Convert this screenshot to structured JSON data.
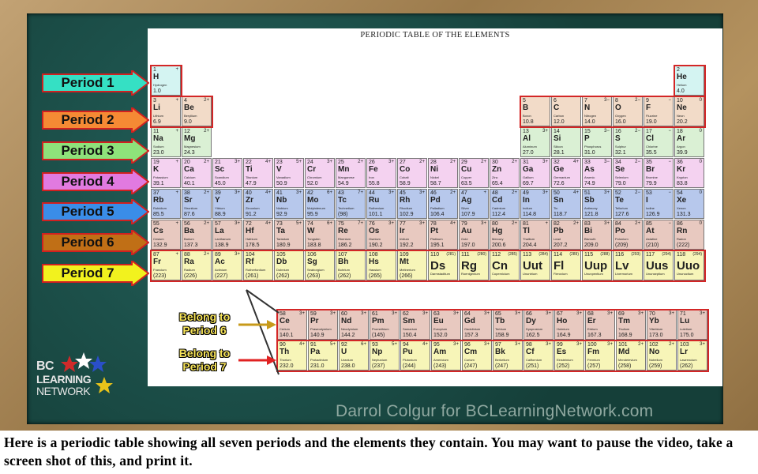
{
  "table_title": "PERIODIC TABLE OF THE ELEMENTS",
  "period_labels": [
    "Period 1",
    "Period 2",
    "Period 3",
    "Period 4",
    "Period 5",
    "Period 6",
    "Period 7"
  ],
  "belong_labels": [
    "Belong to Period 6",
    "Belong to Period 7"
  ],
  "logo": {
    "line1": "BC",
    "line2": "LEARNING",
    "line3": "NETWORK"
  },
  "credit": "Darrol Colgur for BCLearningNetwork.com",
  "caption": "Here is a periodic table showing all seven periods and the elements they contain. You may want to pause the video, take a screen shot of this, and print it.",
  "colors": {
    "period1": "#d4f4f2",
    "period2": "#f2dbc8",
    "period3": "#daf0d4",
    "period4": "#f4d2f0",
    "period5": "#b7c8ec",
    "period6": "#e8c9c0",
    "period7": "#f7f5b8",
    "outline": "#d32626",
    "arrow1": "#35e0c4",
    "arrow2": "#f58a34",
    "arrow3": "#8ee27a",
    "arrow4": "#e17ae0",
    "arrow5": "#3a8de8",
    "arrow6": "#c06f16",
    "arrow7": "#f2f21e"
  },
  "elements": [
    {
      "n": "1",
      "s": "H",
      "name": "Hydrogen",
      "m": "1.0",
      "ox": "+",
      "p": 1,
      "g": 1
    },
    {
      "n": "2",
      "s": "He",
      "name": "Helium",
      "m": "4.0",
      "ox": "",
      "p": 1,
      "g": 18
    },
    {
      "n": "3",
      "s": "Li",
      "name": "Lithium",
      "m": "6.9",
      "ox": "+",
      "p": 2,
      "g": 1
    },
    {
      "n": "4",
      "s": "Be",
      "name": "Beryllium",
      "m": "9.0",
      "ox": "2+",
      "p": 2,
      "g": 2
    },
    {
      "n": "5",
      "s": "B",
      "name": "Boron",
      "m": "10.8",
      "ox": "",
      "p": 2,
      "g": 13
    },
    {
      "n": "6",
      "s": "C",
      "name": "Carbon",
      "m": "12.0",
      "ox": "",
      "p": 2,
      "g": 14
    },
    {
      "n": "7",
      "s": "N",
      "name": "Nitrogen",
      "m": "14.0",
      "ox": "3−",
      "p": 2,
      "g": 15
    },
    {
      "n": "8",
      "s": "O",
      "name": "Oxygen",
      "m": "16.0",
      "ox": "2−",
      "p": 2,
      "g": 16
    },
    {
      "n": "9",
      "s": "F",
      "name": "Fluorine",
      "m": "19.0",
      "ox": "−",
      "p": 2,
      "g": 17
    },
    {
      "n": "10",
      "s": "Ne",
      "name": "Neon",
      "m": "20.2",
      "ox": "0",
      "p": 2,
      "g": 18
    },
    {
      "n": "11",
      "s": "Na",
      "name": "Sodium",
      "m": "23.0",
      "ox": "+",
      "p": 3,
      "g": 1
    },
    {
      "n": "12",
      "s": "Mg",
      "name": "Magnesium",
      "m": "24.3",
      "ox": "2+",
      "p": 3,
      "g": 2
    },
    {
      "n": "13",
      "s": "Al",
      "name": "Aluminum",
      "m": "27.0",
      "ox": "3+",
      "p": 3,
      "g": 13
    },
    {
      "n": "14",
      "s": "Si",
      "name": "Silicon",
      "m": "28.1",
      "ox": "",
      "p": 3,
      "g": 14
    },
    {
      "n": "15",
      "s": "P",
      "name": "Phosphorus",
      "m": "31.0",
      "ox": "3−",
      "p": 3,
      "g": 15
    },
    {
      "n": "16",
      "s": "S",
      "name": "Sulphur",
      "m": "32.1",
      "ox": "2−",
      "p": 3,
      "g": 16
    },
    {
      "n": "17",
      "s": "Cl",
      "name": "Chlorine",
      "m": "35.5",
      "ox": "−",
      "p": 3,
      "g": 17
    },
    {
      "n": "18",
      "s": "Ar",
      "name": "Argon",
      "m": "39.9",
      "ox": "0",
      "p": 3,
      "g": 18
    },
    {
      "n": "19",
      "s": "K",
      "name": "Potassium",
      "m": "39.1",
      "ox": "+",
      "p": 4,
      "g": 1
    },
    {
      "n": "20",
      "s": "Ca",
      "name": "Calcium",
      "m": "40.1",
      "ox": "2+",
      "p": 4,
      "g": 2
    },
    {
      "n": "21",
      "s": "Sc",
      "name": "Scandium",
      "m": "45.0",
      "ox": "3+",
      "p": 4,
      "g": 3
    },
    {
      "n": "22",
      "s": "Ti",
      "name": "Titanium",
      "m": "47.9",
      "ox": "4+",
      "p": 4,
      "g": 4
    },
    {
      "n": "23",
      "s": "V",
      "name": "Vanadium",
      "m": "50.9",
      "ox": "5+",
      "p": 4,
      "g": 5
    },
    {
      "n": "24",
      "s": "Cr",
      "name": "Chromium",
      "m": "52.0",
      "ox": "3+",
      "p": 4,
      "g": 6
    },
    {
      "n": "25",
      "s": "Mn",
      "name": "Manganese",
      "m": "54.9",
      "ox": "2+",
      "p": 4,
      "g": 7
    },
    {
      "n": "26",
      "s": "Fe",
      "name": "Iron",
      "m": "55.8",
      "ox": "3+",
      "p": 4,
      "g": 8
    },
    {
      "n": "27",
      "s": "Co",
      "name": "Cobalt",
      "m": "58.9",
      "ox": "2+",
      "p": 4,
      "g": 9
    },
    {
      "n": "28",
      "s": "Ni",
      "name": "Nickel",
      "m": "58.7",
      "ox": "2+",
      "p": 4,
      "g": 10
    },
    {
      "n": "29",
      "s": "Cu",
      "name": "Copper",
      "m": "63.5",
      "ox": "2+",
      "p": 4,
      "g": 11
    },
    {
      "n": "30",
      "s": "Zn",
      "name": "Zinc",
      "m": "65.4",
      "ox": "2+",
      "p": 4,
      "g": 12
    },
    {
      "n": "31",
      "s": "Ga",
      "name": "Gallium",
      "m": "69.7",
      "ox": "3+",
      "p": 4,
      "g": 13
    },
    {
      "n": "32",
      "s": "Ge",
      "name": "Germanium",
      "m": "72.6",
      "ox": "4+",
      "p": 4,
      "g": 14
    },
    {
      "n": "33",
      "s": "As",
      "name": "Arsenic",
      "m": "74.9",
      "ox": "3−",
      "p": 4,
      "g": 15
    },
    {
      "n": "34",
      "s": "Se",
      "name": "Selenium",
      "m": "79.0",
      "ox": "2−",
      "p": 4,
      "g": 16
    },
    {
      "n": "35",
      "s": "Br",
      "name": "Bromine",
      "m": "79.9",
      "ox": "−",
      "p": 4,
      "g": 17
    },
    {
      "n": "36",
      "s": "Kr",
      "name": "Krypton",
      "m": "83.8",
      "ox": "0",
      "p": 4,
      "g": 18
    },
    {
      "n": "37",
      "s": "Rb",
      "name": "Rubidium",
      "m": "85.5",
      "ox": "+",
      "p": 5,
      "g": 1
    },
    {
      "n": "38",
      "s": "Sr",
      "name": "Strontium",
      "m": "87.6",
      "ox": "2+",
      "p": 5,
      "g": 2
    },
    {
      "n": "39",
      "s": "Y",
      "name": "Yttrium",
      "m": "88.9",
      "ox": "3+",
      "p": 5,
      "g": 3
    },
    {
      "n": "40",
      "s": "Zr",
      "name": "Zirconium",
      "m": "91.2",
      "ox": "4+",
      "p": 5,
      "g": 4
    },
    {
      "n": "41",
      "s": "Nb",
      "name": "Niobium",
      "m": "92.9",
      "ox": "3+",
      "p": 5,
      "g": 5
    },
    {
      "n": "42",
      "s": "Mo",
      "name": "Molybdenum",
      "m": "95.9",
      "ox": "6+",
      "p": 5,
      "g": 6
    },
    {
      "n": "43",
      "s": "Tc",
      "name": "Technetium",
      "m": "(98)",
      "ox": "7+",
      "p": 5,
      "g": 7
    },
    {
      "n": "44",
      "s": "Ru",
      "name": "Ruthenium",
      "m": "101.1",
      "ox": "3+",
      "p": 5,
      "g": 8
    },
    {
      "n": "45",
      "s": "Rh",
      "name": "Rhodium",
      "m": "102.9",
      "ox": "3+",
      "p": 5,
      "g": 9
    },
    {
      "n": "46",
      "s": "Pd",
      "name": "Palladium",
      "m": "106.4",
      "ox": "2+",
      "p": 5,
      "g": 10
    },
    {
      "n": "47",
      "s": "Ag",
      "name": "Silver",
      "m": "107.9",
      "ox": "+",
      "p": 5,
      "g": 11
    },
    {
      "n": "48",
      "s": "Cd",
      "name": "Cadmium",
      "m": "112.4",
      "ox": "2+",
      "p": 5,
      "g": 12
    },
    {
      "n": "49",
      "s": "In",
      "name": "Indium",
      "m": "114.8",
      "ox": "3+",
      "p": 5,
      "g": 13
    },
    {
      "n": "50",
      "s": "Sn",
      "name": "Tin",
      "m": "118.7",
      "ox": "4+",
      "p": 5,
      "g": 14
    },
    {
      "n": "51",
      "s": "Sb",
      "name": "Antimony",
      "m": "121.8",
      "ox": "3+",
      "p": 5,
      "g": 15
    },
    {
      "n": "52",
      "s": "Te",
      "name": "Tellurium",
      "m": "127.6",
      "ox": "2−",
      "p": 5,
      "g": 16
    },
    {
      "n": "53",
      "s": "I",
      "name": "Iodine",
      "m": "126.9",
      "ox": "−",
      "p": 5,
      "g": 17
    },
    {
      "n": "54",
      "s": "Xe",
      "name": "Xenon",
      "m": "131.3",
      "ox": "0",
      "p": 5,
      "g": 18
    },
    {
      "n": "55",
      "s": "Cs",
      "name": "Cesium",
      "m": "132.9",
      "ox": "+",
      "p": 6,
      "g": 1
    },
    {
      "n": "56",
      "s": "Ba",
      "name": "Barium",
      "m": "137.3",
      "ox": "2+",
      "p": 6,
      "g": 2
    },
    {
      "n": "57",
      "s": "La",
      "name": "Lanthanum",
      "m": "138.9",
      "ox": "3+",
      "p": 6,
      "g": 3
    },
    {
      "n": "72",
      "s": "Hf",
      "name": "Hafnium",
      "m": "178.5",
      "ox": "4+",
      "p": 6,
      "g": 4
    },
    {
      "n": "73",
      "s": "Ta",
      "name": "Tantalum",
      "m": "180.9",
      "ox": "5+",
      "p": 6,
      "g": 5
    },
    {
      "n": "74",
      "s": "W",
      "name": "Tungsten",
      "m": "183.8",
      "ox": "6+",
      "p": 6,
      "g": 6
    },
    {
      "n": "75",
      "s": "Re",
      "name": "Rhenium",
      "m": "186.2",
      "ox": "7+",
      "p": 6,
      "g": 7
    },
    {
      "n": "76",
      "s": "Os",
      "name": "Osmium",
      "m": "190.2",
      "ox": "3+",
      "p": 6,
      "g": 8
    },
    {
      "n": "77",
      "s": "Ir",
      "name": "Iridium",
      "m": "192.2",
      "ox": "3+",
      "p": 6,
      "g": 9
    },
    {
      "n": "78",
      "s": "Pt",
      "name": "Platinum",
      "m": "195.1",
      "ox": "4+",
      "p": 6,
      "g": 10
    },
    {
      "n": "79",
      "s": "Au",
      "name": "Gold",
      "m": "197.0",
      "ox": "3+",
      "p": 6,
      "g": 11
    },
    {
      "n": "80",
      "s": "Hg",
      "name": "Mercury",
      "m": "200.6",
      "ox": "2+",
      "p": 6,
      "g": 12
    },
    {
      "n": "81",
      "s": "Tl",
      "name": "Thallium",
      "m": "204.4",
      "ox": "+",
      "p": 6,
      "g": 13
    },
    {
      "n": "82",
      "s": "Pb",
      "name": "Lead",
      "m": "207.2",
      "ox": "2+",
      "p": 6,
      "g": 14
    },
    {
      "n": "83",
      "s": "Bi",
      "name": "Bismuth",
      "m": "209.0",
      "ox": "3+",
      "p": 6,
      "g": 15
    },
    {
      "n": "84",
      "s": "Po",
      "name": "Polonium",
      "m": "(209)",
      "ox": "2+",
      "p": 6,
      "g": 16
    },
    {
      "n": "85",
      "s": "At",
      "name": "Astatine",
      "m": "(210)",
      "ox": "−",
      "p": 6,
      "g": 17
    },
    {
      "n": "86",
      "s": "Rn",
      "name": "Radon",
      "m": "(222)",
      "ox": "0",
      "p": 6,
      "g": 18
    },
    {
      "n": "87",
      "s": "Fr",
      "name": "Francium",
      "m": "(223)",
      "ox": "+",
      "p": 7,
      "g": 1
    },
    {
      "n": "88",
      "s": "Ra",
      "name": "Radium",
      "m": "(226)",
      "ox": "2+",
      "p": 7,
      "g": 2
    },
    {
      "n": "89",
      "s": "Ac",
      "name": "Actinium",
      "m": "(227)",
      "ox": "3+",
      "p": 7,
      "g": 3
    },
    {
      "n": "104",
      "s": "Rf",
      "name": "Rutherfordium",
      "m": "(261)",
      "ox": "",
      "p": 7,
      "g": 4
    },
    {
      "n": "105",
      "s": "Db",
      "name": "Dubnium",
      "m": "(262)",
      "ox": "",
      "p": 7,
      "g": 5
    },
    {
      "n": "106",
      "s": "Sg",
      "name": "Seaborgium",
      "m": "(263)",
      "ox": "",
      "p": 7,
      "g": 6
    },
    {
      "n": "107",
      "s": "Bh",
      "name": "Bohrium",
      "m": "(262)",
      "ox": "",
      "p": 7,
      "g": 7
    },
    {
      "n": "108",
      "s": "Hs",
      "name": "Hassium",
      "m": "(265)",
      "ox": "",
      "p": 7,
      "g": 8
    },
    {
      "n": "109",
      "s": "Mt",
      "name": "Meitnerium",
      "m": "(266)",
      "ox": "",
      "p": 7,
      "g": 9
    },
    {
      "n": "110",
      "s": "Ds",
      "name": "Darmstadtium",
      "m": "",
      "ox": "(281)",
      "p": 7,
      "g": 10,
      "big": true
    },
    {
      "n": "111",
      "s": "Rg",
      "name": "Roentgenium",
      "m": "",
      "ox": "(280)",
      "p": 7,
      "g": 11,
      "big": true
    },
    {
      "n": "112",
      "s": "Cn",
      "name": "Copernicium",
      "m": "",
      "ox": "(285)",
      "p": 7,
      "g": 12,
      "big": true
    },
    {
      "n": "113",
      "s": "Uut",
      "name": "Ununtrium",
      "m": "",
      "ox": "(284)",
      "p": 7,
      "g": 13,
      "big": true
    },
    {
      "n": "114",
      "s": "Fl",
      "name": "Flerovium",
      "m": "",
      "ox": "(289)",
      "p": 7,
      "g": 14,
      "big": true
    },
    {
      "n": "115",
      "s": "Uup",
      "name": "Ununpentium",
      "m": "",
      "ox": "(288)",
      "p": 7,
      "g": 15,
      "big": true
    },
    {
      "n": "116",
      "s": "Lv",
      "name": "Livermorium",
      "m": "",
      "ox": "(293)",
      "p": 7,
      "g": 16,
      "big": true
    },
    {
      "n": "117",
      "s": "Uus",
      "name": "Ununseptium",
      "m": "",
      "ox": "(294)",
      "p": 7,
      "g": 17,
      "big": true
    },
    {
      "n": "118",
      "s": "Uuo",
      "name": "Ununoctium",
      "m": "",
      "ox": "(294)",
      "p": 7,
      "g": 18,
      "big": true
    },
    {
      "n": "58",
      "s": "Ce",
      "name": "Cerium",
      "m": "140.1",
      "ox": "3+",
      "p": 6,
      "f": 0
    },
    {
      "n": "59",
      "s": "Pr",
      "name": "Praseodymium",
      "m": "140.9",
      "ox": "3+",
      "p": 6,
      "f": 1
    },
    {
      "n": "60",
      "s": "Nd",
      "name": "Neodymium",
      "m": "144.2",
      "ox": "3+",
      "p": 6,
      "f": 2
    },
    {
      "n": "61",
      "s": "Pm",
      "name": "Promethium",
      "m": "(145)",
      "ox": "3+",
      "p": 6,
      "f": 3
    },
    {
      "n": "62",
      "s": "Sm",
      "name": "Samarium",
      "m": "150.4",
      "ox": "3+",
      "p": 6,
      "f": 4
    },
    {
      "n": "63",
      "s": "Eu",
      "name": "Europium",
      "m": "152.0",
      "ox": "3+",
      "p": 6,
      "f": 5
    },
    {
      "n": "64",
      "s": "Gd",
      "name": "Gadolinium",
      "m": "157.3",
      "ox": "3+",
      "p": 6,
      "f": 6
    },
    {
      "n": "65",
      "s": "Tb",
      "name": "Terbium",
      "m": "158.9",
      "ox": "3+",
      "p": 6,
      "f": 7
    },
    {
      "n": "66",
      "s": "Dy",
      "name": "Dysprosium",
      "m": "162.5",
      "ox": "3+",
      "p": 6,
      "f": 8
    },
    {
      "n": "67",
      "s": "Ho",
      "name": "Holmium",
      "m": "164.9",
      "ox": "3+",
      "p": 6,
      "f": 9
    },
    {
      "n": "68",
      "s": "Er",
      "name": "Erbium",
      "m": "167.3",
      "ox": "3+",
      "p": 6,
      "f": 10
    },
    {
      "n": "69",
      "s": "Tm",
      "name": "Thulium",
      "m": "168.9",
      "ox": "3+",
      "p": 6,
      "f": 11
    },
    {
      "n": "70",
      "s": "Yb",
      "name": "Ytterbium",
      "m": "173.0",
      "ox": "3+",
      "p": 6,
      "f": 12
    },
    {
      "n": "71",
      "s": "Lu",
      "name": "Lutetium",
      "m": "175.0",
      "ox": "3+",
      "p": 6,
      "f": 13
    },
    {
      "n": "90",
      "s": "Th",
      "name": "Thorium",
      "m": "232.0",
      "ox": "4+",
      "p": 7,
      "f": 0
    },
    {
      "n": "91",
      "s": "Pa",
      "name": "Protactinium",
      "m": "231.0",
      "ox": "5+",
      "p": 7,
      "f": 1
    },
    {
      "n": "92",
      "s": "U",
      "name": "Uranium",
      "m": "238.0",
      "ox": "6+",
      "p": 7,
      "f": 2
    },
    {
      "n": "93",
      "s": "Np",
      "name": "Neptunium",
      "m": "(237)",
      "ox": "5+",
      "p": 7,
      "f": 3
    },
    {
      "n": "94",
      "s": "Pu",
      "name": "Plutonium",
      "m": "(244)",
      "ox": "4+",
      "p": 7,
      "f": 4
    },
    {
      "n": "95",
      "s": "Am",
      "name": "Americium",
      "m": "(243)",
      "ox": "3+",
      "p": 7,
      "f": 5
    },
    {
      "n": "96",
      "s": "Cm",
      "name": "Curium",
      "m": "(247)",
      "ox": "3+",
      "p": 7,
      "f": 6
    },
    {
      "n": "97",
      "s": "Bk",
      "name": "Berkelium",
      "m": "(247)",
      "ox": "3+",
      "p": 7,
      "f": 7
    },
    {
      "n": "98",
      "s": "Cf",
      "name": "Californium",
      "m": "(251)",
      "ox": "3+",
      "p": 7,
      "f": 8
    },
    {
      "n": "99",
      "s": "Es",
      "name": "Einsteinium",
      "m": "(252)",
      "ox": "3+",
      "p": 7,
      "f": 9
    },
    {
      "n": "100",
      "s": "Fm",
      "name": "Fermium",
      "m": "(257)",
      "ox": "3+",
      "p": 7,
      "f": 10
    },
    {
      "n": "101",
      "s": "Md",
      "name": "Mendelevium",
      "m": "(258)",
      "ox": "2+",
      "p": 7,
      "f": 11
    },
    {
      "n": "102",
      "s": "No",
      "name": "Nobelium",
      "m": "(259)",
      "ox": "2+",
      "p": 7,
      "f": 12
    },
    {
      "n": "103",
      "s": "Lr",
      "name": "Lawrencium",
      "m": "(262)",
      "ox": "3+",
      "p": 7,
      "f": 13
    }
  ]
}
